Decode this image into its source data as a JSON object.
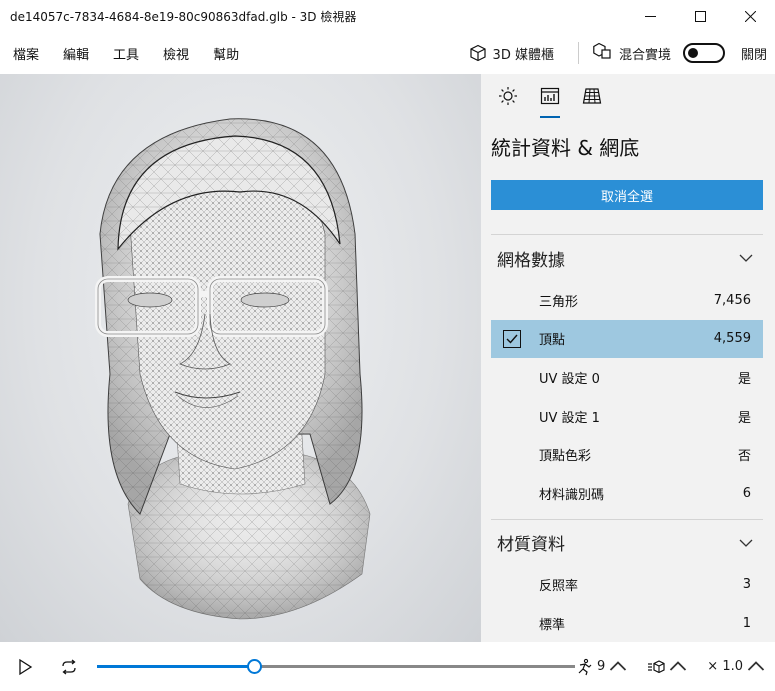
{
  "window": {
    "title": "de14057c-7834-4684-8e19-80c90863dfad.glb - 3D 檢視器"
  },
  "menu": {
    "items": [
      {
        "label": "檔案"
      },
      {
        "label": "編輯"
      },
      {
        "label": "工具"
      },
      {
        "label": "檢視"
      },
      {
        "label": "幫助"
      }
    ],
    "library_label": "3D 媒體櫃",
    "mixed_reality_label": "混合實境",
    "toggle_state_label": "關閉"
  },
  "panel": {
    "title": "統計資料 & 網底",
    "deselect_label": "取消全選",
    "mesh_section": {
      "title": "網格數據",
      "rows": [
        {
          "label": "三角形",
          "value": "7,456"
        },
        {
          "label": "頂點",
          "value": "4,559"
        },
        {
          "label": "UV 設定 0",
          "value": "是"
        },
        {
          "label": "UV 設定 1",
          "value": "是"
        },
        {
          "label": "頂點色彩",
          "value": "否"
        },
        {
          "label": "材料識別碼",
          "value": "6"
        }
      ]
    },
    "material_section": {
      "title": "材質資料",
      "rows": [
        {
          "label": "反照率",
          "value": "3"
        },
        {
          "label": "標準",
          "value": "1"
        }
      ]
    }
  },
  "bottom": {
    "timeline_progress": 0.33,
    "animation_count": "9",
    "speed_label": "× 1.0"
  },
  "colors": {
    "accent": "#0078d7",
    "button_blue": "#2b8fd6",
    "selected_row": "#9ec8e0",
    "panel_bg": "#f2f2f2"
  }
}
